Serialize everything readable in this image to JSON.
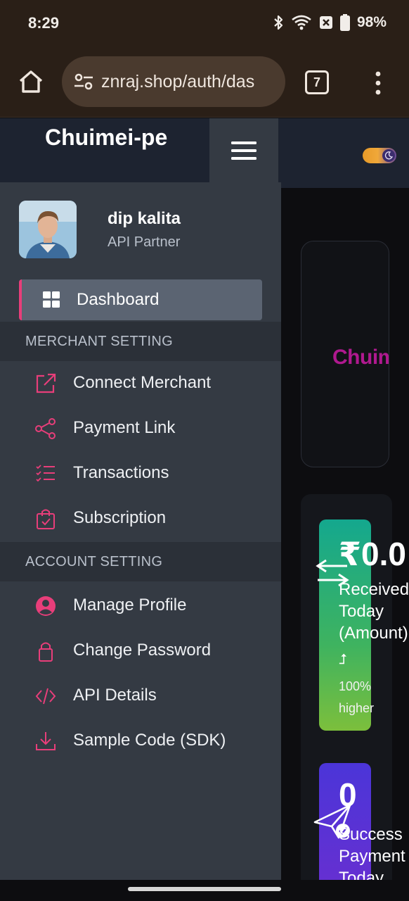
{
  "status_bar": {
    "time": "8:29",
    "battery": "98%",
    "icons": [
      "bluetooth-icon",
      "wifi-icon",
      "battery-saver-icon",
      "battery-icon"
    ]
  },
  "browser": {
    "url": "znraj.shop/auth/das",
    "tab_count": "7"
  },
  "sidebar": {
    "brand": "Chuimei-pe",
    "user": {
      "name": "dip kalita",
      "role": "API Partner"
    },
    "dashboard_label": "Dashboard",
    "sections": [
      {
        "title": "MERCHANT SETTING",
        "items": [
          {
            "label": "Connect Merchant",
            "icon": "external-link-icon"
          },
          {
            "label": "Payment Link",
            "icon": "share-icon"
          },
          {
            "label": "Transactions",
            "icon": "checklist-icon"
          },
          {
            "label": "Subscription",
            "icon": "shopping-bag-icon"
          }
        ]
      },
      {
        "title": "ACCOUNT SETTING",
        "items": [
          {
            "label": "Manage Profile",
            "icon": "user-circle-icon"
          },
          {
            "label": "Change Password",
            "icon": "lock-icon"
          },
          {
            "label": "API Details",
            "icon": "code-icon"
          },
          {
            "label": "Sample Code (SDK)",
            "icon": "download-icon"
          }
        ]
      }
    ]
  },
  "main": {
    "logo_text": "Chuimei",
    "stats": [
      {
        "value": "₹0.0",
        "label": "Received Today (Amount)",
        "change": "100% higher"
      },
      {
        "value": "0",
        "label": "Success Payment Today"
      }
    ]
  },
  "colors": {
    "accent": "#e83e7a",
    "sidebar_bg": "#343a43",
    "header_bg": "#1d2330",
    "card_green": "#3fb35f",
    "card_purple": "#5b33d4"
  }
}
